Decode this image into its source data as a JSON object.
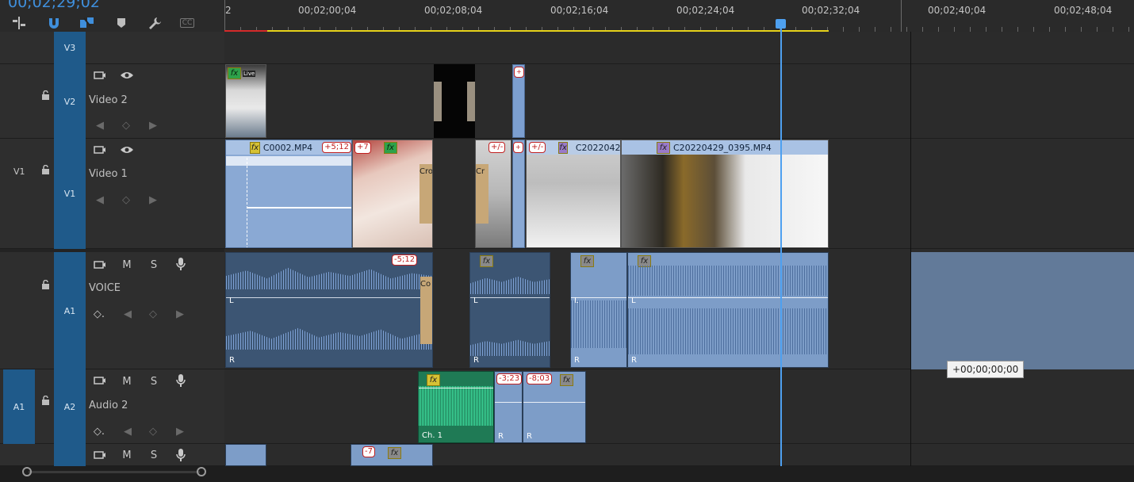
{
  "header": {
    "timecode": "00;02;29;02",
    "tools": [
      {
        "icon": "insert-sequence-icon"
      },
      {
        "icon": "snap-magnet-icon"
      },
      {
        "icon": "linked-selection-icon"
      },
      {
        "icon": "add-marker-icon"
      },
      {
        "icon": "wrench-settings-icon"
      },
      {
        "icon": "captions-cc-icon",
        "label": "CC"
      }
    ]
  },
  "ruler": {
    "start_label": "2",
    "labels": [
      "00;02;00;04",
      "00;02;08;04",
      "00;02;16;04",
      "00;02;24;04",
      "00;02;32;04",
      "00;02;40;04",
      "00;02;48;04"
    ]
  },
  "tracks": {
    "v3": {
      "target": "V3"
    },
    "v2": {
      "target": "V2",
      "name": "Video 2"
    },
    "v1": {
      "source": "V1",
      "target": "V1",
      "name": "Video 1"
    },
    "a1": {
      "target": "A1",
      "name": "VOICE",
      "mute": "M",
      "solo": "S"
    },
    "a2": {
      "source": "A1",
      "target": "A2",
      "name": "Audio 2",
      "mute": "M",
      "solo": "S"
    },
    "a3": {
      "mute": "M",
      "solo": "S"
    }
  },
  "clips": {
    "v2_live": "Live",
    "v1_c0002": "C0002.MP4",
    "v1_badge1": "+5;12",
    "v1_badge2": "+7",
    "v1_cro": "Cro",
    "v1_cr": "Cr",
    "v1_badge3": "+/-",
    "v1_badge4": "+",
    "v1_badge5": "+/-",
    "v1_c2022042": "C2022042",
    "v1_c20220429": "C20220429_0395.MP4",
    "a1_badge": "-5;12",
    "a1_co": "Co",
    "a2_ch1": "Ch. 1",
    "a2_badge1": "-3;23",
    "a2_badge2": "-8;03",
    "a3_badge": "-7",
    "channel_l": "L",
    "channel_r": "R",
    "fx": "fx"
  },
  "tooltip": "+00;00;00;00",
  "colors": {
    "playhead": "#4ea0f0",
    "video_clip": "#8aa9d4",
    "audio_clip": "#3c5573",
    "audio_clip_green": "#2fd08f",
    "track_target": "#1f5a8a",
    "work_area": "#e6d21a"
  }
}
